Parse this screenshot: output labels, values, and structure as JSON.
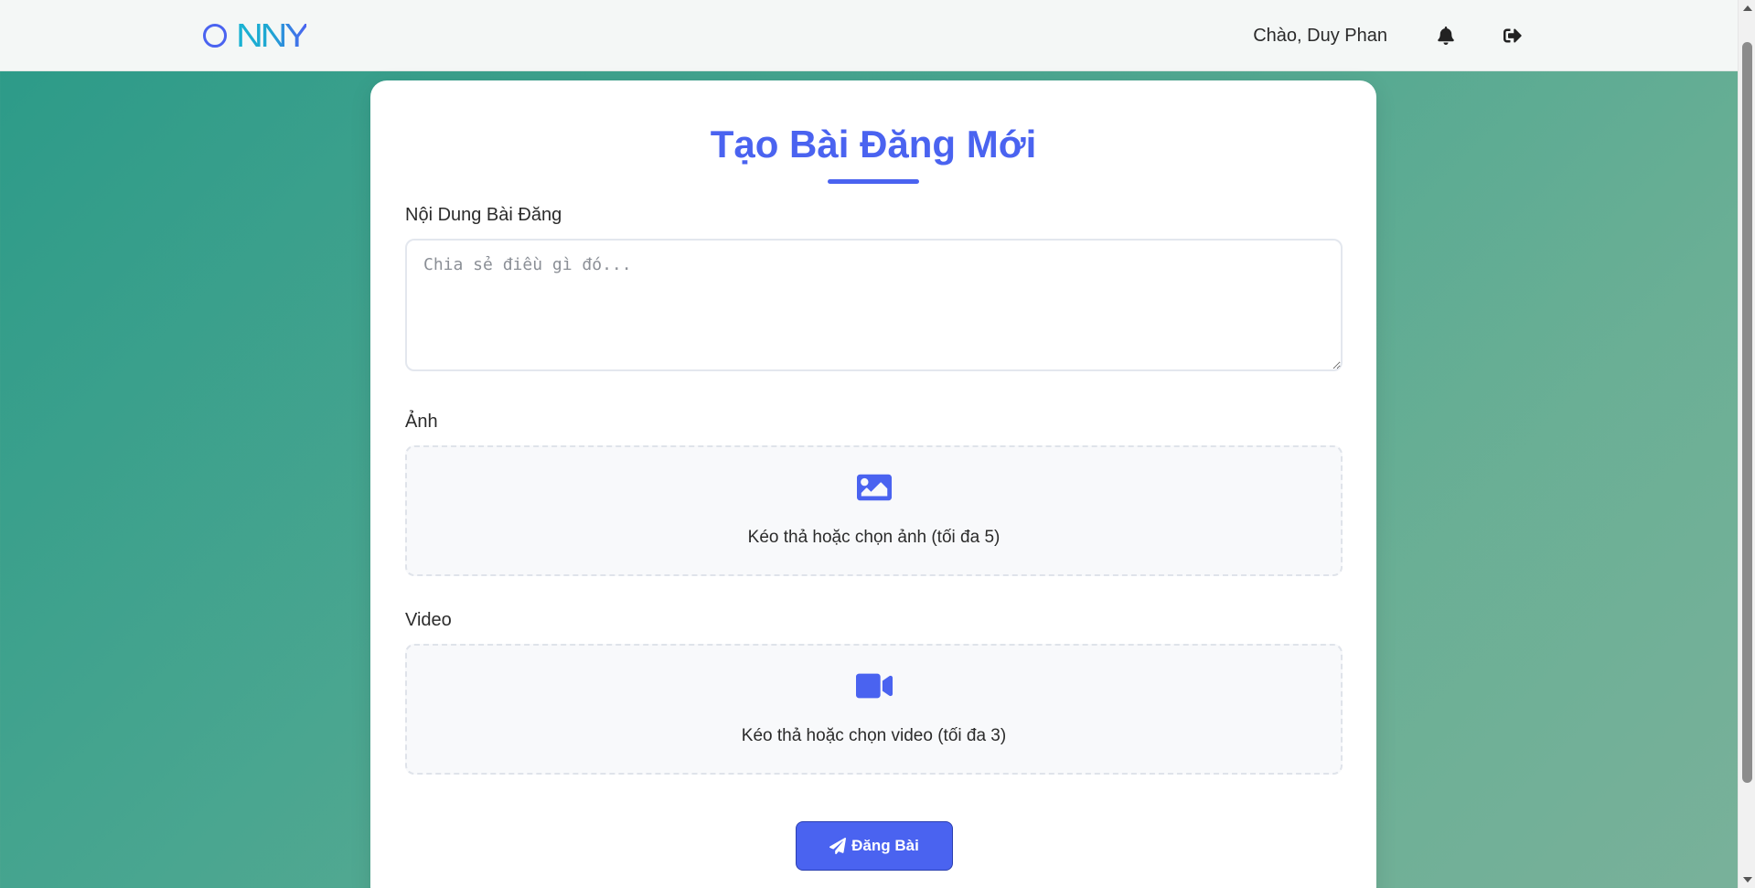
{
  "navbar": {
    "logo_text": "NNY",
    "greeting": "Chào, Duy Phan",
    "icons": [
      "bell-icon",
      "sign-out-icon"
    ]
  },
  "form": {
    "title": "Tạo Bài Đăng Mới",
    "content_label": "Nội Dung Bài Đăng",
    "content_placeholder": "Chia sẻ điều gì đó...",
    "content_value": "",
    "image_label": "Ảnh",
    "image_dropzone_text": "Kéo thả hoặc chọn ảnh (tối đa 5)",
    "video_label": "Video",
    "video_dropzone_text": "Kéo thả hoặc chọn video (tối đa 3)",
    "submit_label": "Đăng Bài"
  },
  "colors": {
    "accent": "#4a63f0",
    "background_start": "#2b9a88",
    "background_end": "#79b19a"
  }
}
